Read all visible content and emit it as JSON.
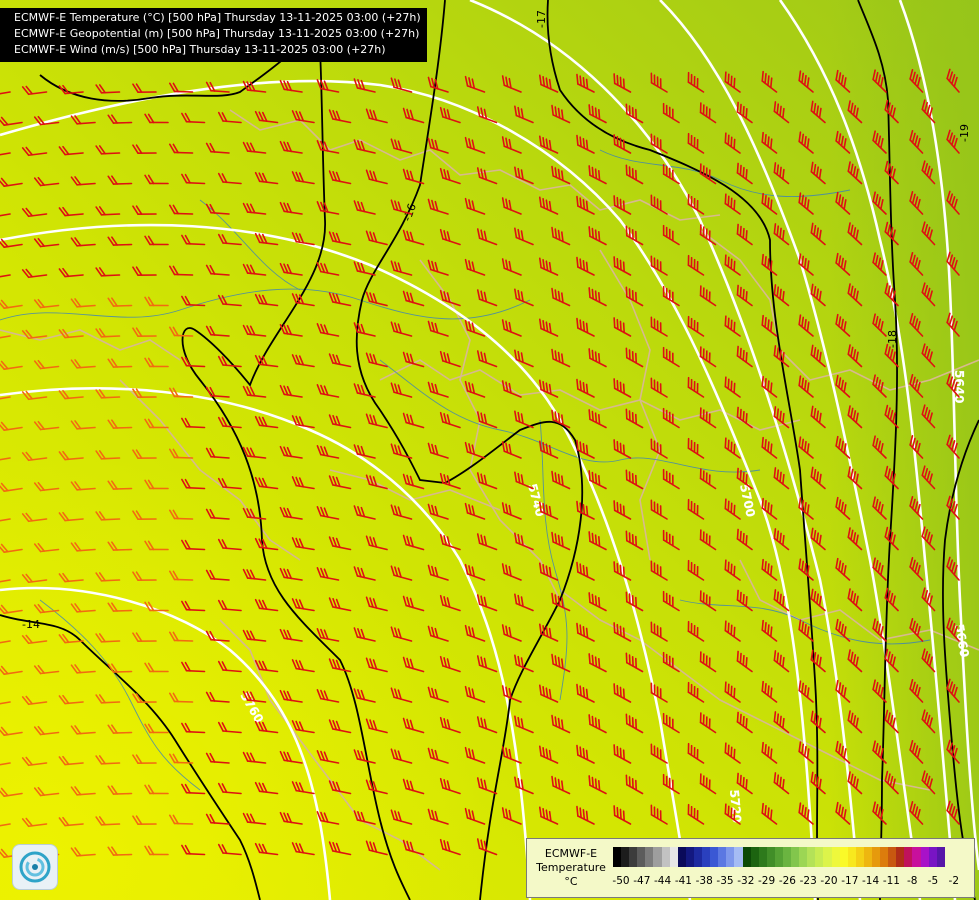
{
  "header": {
    "lines": [
      "ECMWF-E Temperature (°C) [500 hPa] Thursday 13-11-2025 03:00 (+27h)",
      "ECMWF-E Geopotential (m) [500 hPa] Thursday 13-11-2025 03:00 (+27h)",
      "ECMWF-E Wind (m/s) [500 hPa] Thursday 13-11-2025 03:00 (+27h)"
    ]
  },
  "map": {
    "geopotential_labels": [
      "5740",
      "5700",
      "5760",
      "5720",
      "5640",
      "5660"
    ],
    "temperature_labels": [
      "-17",
      "-16",
      "-19",
      "-18",
      "-14"
    ],
    "colors": {
      "field_warm": "#e4ee00",
      "field_cold": "#a4cc16",
      "geopotential_contour": "#ffffff",
      "temperature_contour": "#000000",
      "wind_barb": "#dd1111",
      "wind_barb_slow": "#f26b10",
      "borders": "#d7b98f",
      "rivers": "#2f7ac8"
    }
  },
  "legend": {
    "title": [
      "ECMWF-E",
      "Temperature",
      "°C"
    ],
    "ticks": [
      "-50",
      "-47",
      "-44",
      "-41",
      "-38",
      "-35",
      "-32",
      "-29",
      "-26",
      "-23",
      "-20",
      "-17",
      "-14",
      "-11",
      "-8",
      "-5",
      "-2"
    ],
    "colors": [
      "#000000",
      "#1c1c1c",
      "#3c3c3c",
      "#5c5c5c",
      "#7c7c7c",
      "#9e9e9e",
      "#c2c2c2",
      "#e6e6e6",
      "#0a0a5a",
      "#131880",
      "#1d2aa0",
      "#2a40be",
      "#3a58d4",
      "#5b78e2",
      "#7e98ec",
      "#a5bcf4",
      "#0c4a06",
      "#1c6410",
      "#2e7a1c",
      "#418e28",
      "#55a234",
      "#6ab440",
      "#82c64c",
      "#9cd654",
      "#b4e258",
      "#c8ec52",
      "#dcf44a",
      "#eef83c",
      "#fafa28",
      "#f8e81e",
      "#f4d016",
      "#eeb610",
      "#e69a0c",
      "#dc7c0c",
      "#c85810",
      "#b02e18",
      "#c0125c",
      "#c8109c",
      "#a812c8",
      "#7814c4",
      "#5616a8"
    ]
  }
}
